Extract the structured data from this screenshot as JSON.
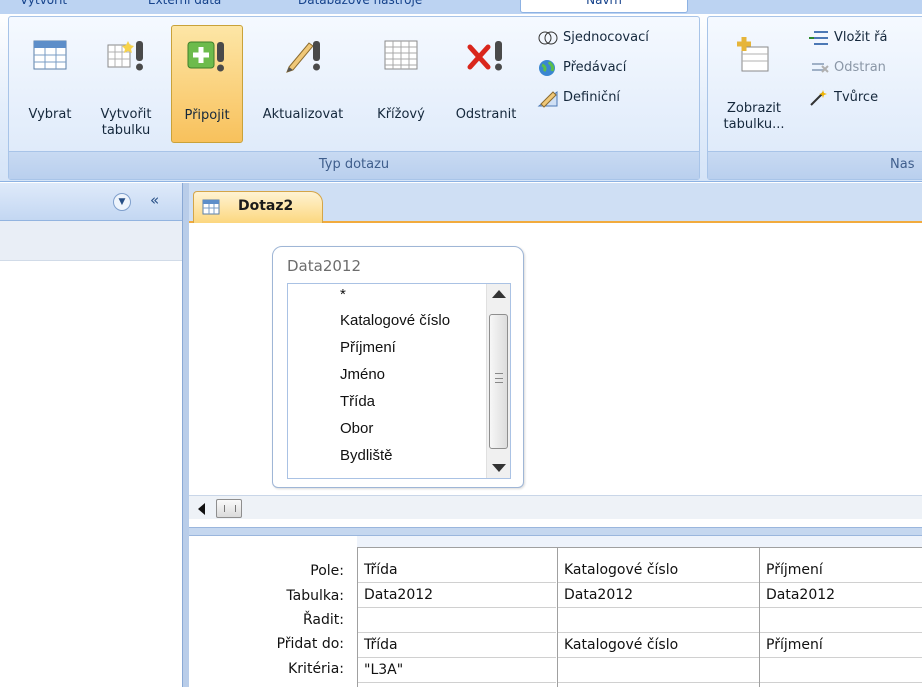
{
  "ribbon": {
    "tabs": [
      "Vytvořit",
      "Externí data",
      "Databázové nástroje",
      "Návrh"
    ],
    "groups": {
      "query_type": {
        "label": "Typ dotazu",
        "buttons": [
          "Vybrat",
          "Vytvořit tabulku",
          "Připojit",
          "Aktualizovat",
          "Křížový",
          "Odstranit"
        ],
        "pressed": "Připojit",
        "small_buttons": [
          "Sjednocovací",
          "Předávací",
          "Definiční"
        ]
      },
      "query_setup": {
        "label": "Nas",
        "big_button": "Zobrazit tabulku...",
        "small_buttons": [
          "Vložit řá",
          "Odstran",
          "Tvůrce"
        ]
      }
    }
  },
  "navpane": {
    "dropdown_icon": "chevron-down-icon",
    "collapse_label": "«"
  },
  "document": {
    "tab_label": "Dotaz2",
    "table": {
      "name": "Data2012",
      "fields": [
        "*",
        "Katalogové číslo",
        "Příjmení",
        "Jméno",
        "Třída",
        "Obor",
        "Bydliště"
      ]
    },
    "grid": {
      "row_labels": [
        "Pole:",
        "Tabulka:",
        "Řadit:",
        "Přidat do:",
        "Kritéria:"
      ],
      "columns": [
        {
          "field": "Třída",
          "table": "Data2012",
          "sort": "",
          "append_to": "Třída",
          "criteria": "\"L3A\""
        },
        {
          "field": "Katalogové číslo",
          "table": "Data2012",
          "sort": "",
          "append_to": "Katalogové číslo",
          "criteria": ""
        },
        {
          "field": "Příjmení",
          "table": "Data2012",
          "sort": "",
          "append_to": "Příjmení",
          "criteria": ""
        }
      ]
    }
  }
}
